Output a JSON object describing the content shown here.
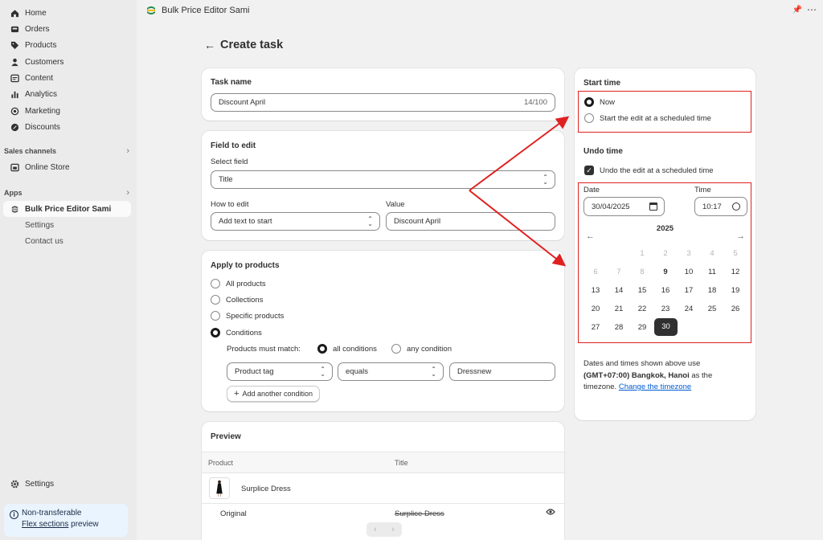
{
  "sidebar": {
    "items": [
      {
        "label": "Home",
        "icon": "home-icon"
      },
      {
        "label": "Orders",
        "icon": "orders-icon"
      },
      {
        "label": "Products",
        "icon": "tag-icon"
      },
      {
        "label": "Customers",
        "icon": "person-icon"
      },
      {
        "label": "Content",
        "icon": "content-icon"
      },
      {
        "label": "Analytics",
        "icon": "bar-chart-icon"
      },
      {
        "label": "Marketing",
        "icon": "target-icon"
      },
      {
        "label": "Discounts",
        "icon": "discount-icon"
      }
    ],
    "sales_channels_heading": "Sales channels",
    "online_store": "Online Store",
    "apps_heading": "Apps",
    "app_name": "Bulk Price Editor Sami",
    "app_sub": [
      "Settings",
      "Contact us"
    ],
    "settings": "Settings",
    "notice_title": "Non-transferable",
    "notice_link": "Flex sections",
    "notice_suffix": " preview"
  },
  "topbar": {
    "title": "Bulk Price Editor Sami"
  },
  "page": {
    "back": "←",
    "title": "Create task"
  },
  "task_name": {
    "heading": "Task name",
    "value": "Discount April",
    "counter": "14/100"
  },
  "field_to_edit": {
    "heading": "Field to edit",
    "select_label": "Select field",
    "select_value": "Title",
    "how_label": "How to edit",
    "how_value": "Add text to start",
    "value_label": "Value",
    "value_value": "Discount April"
  },
  "apply": {
    "heading": "Apply to products",
    "options": [
      "All products",
      "Collections",
      "Specific products",
      "Conditions"
    ],
    "selected": "Conditions",
    "match_label": "Products must match:",
    "match_all": "all conditions",
    "match_any": "any condition",
    "cond_field": "Product tag",
    "cond_op": "equals",
    "cond_value": "Dressnew",
    "add_condition": "Add another condition"
  },
  "preview": {
    "heading": "Preview",
    "col_product": "Product",
    "col_title": "Title",
    "product_name": "Surplice Dress",
    "original_label": "Original",
    "original_title": "Surplice Dress"
  },
  "start_time": {
    "heading": "Start time",
    "now": "Now",
    "scheduled": "Start the edit at a scheduled time"
  },
  "undo_time": {
    "heading": "Undo time",
    "checkbox": "Undo the edit at a scheduled time",
    "date_label": "Date",
    "date_value": "30/04/2025",
    "time_label": "Time",
    "time_value": "10:17",
    "year": "2025",
    "weeks": [
      [
        "",
        "",
        "1",
        "2",
        "3",
        "4",
        "5"
      ],
      [
        "6",
        "7",
        "8",
        "9",
        "10",
        "11",
        "12"
      ],
      [
        "13",
        "14",
        "15",
        "16",
        "17",
        "18",
        "19"
      ],
      [
        "20",
        "21",
        "22",
        "23",
        "24",
        "25",
        "26"
      ],
      [
        "27",
        "28",
        "29",
        "30",
        "",
        "",
        ""
      ]
    ],
    "selected_day": "30"
  },
  "timezone": {
    "text1": "Dates and times shown above use",
    "tz": "(GMT+07:00) Bangkok, Hanoi",
    "text2": " as the",
    "text3": "timezone. ",
    "link": "Change the timezone"
  },
  "colors": {
    "annotation": "#e02020",
    "selected": "#303030",
    "link": "#005bd3"
  }
}
